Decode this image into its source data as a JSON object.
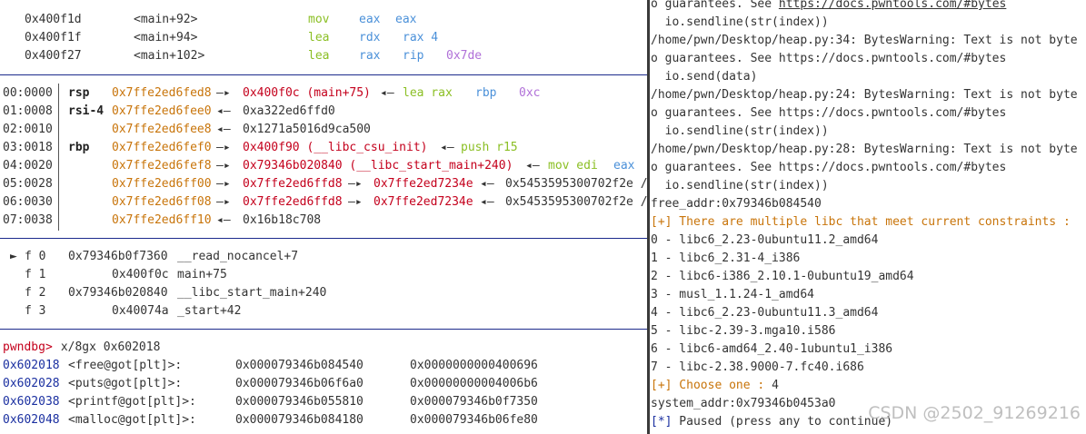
{
  "disasm": [
    {
      "addr": "0x400f1d",
      "sym": "<main+92>",
      "mn": "mov",
      "o1": "eax",
      "o2": "eax",
      "o3": ""
    },
    {
      "addr": "0x400f1f",
      "sym": "<main+94>",
      "mn": "lea",
      "o1": "rdx",
      "o2": "rax 4",
      "o3": ""
    },
    {
      "addr": "0x400f27",
      "sym": "<main+102>",
      "mn": "lea",
      "o1": "rax",
      "o2": "rip",
      "o3": "0x7de"
    }
  ],
  "stack": [
    {
      "off": "00:0000",
      "reg": "rsp",
      "addr": "0x7ffe2ed6fed8",
      "arrow": "—▸",
      "v1": "0x400f0c (main+75)",
      "a2": "◂—",
      "v2": "lea rax",
      "v3": "rbp",
      "v4": "0xc"
    },
    {
      "off": "01:0008",
      "reg": "rsi-4",
      "addr": "0x7ffe2ed6fee0",
      "arrow": "◂—",
      "v1": "0xa322ed6ffd0"
    },
    {
      "off": "02:0010",
      "reg": "",
      "addr": "0x7ffe2ed6fee8",
      "arrow": "◂—",
      "v1": "0x1271a5016d9ca500"
    },
    {
      "off": "03:0018",
      "reg": "rbp",
      "addr": "0x7ffe2ed6fef0",
      "arrow": "—▸",
      "v1": "0x400f90 (__libc_csu_init)",
      "a2": "◂—",
      "v2": "push r15"
    },
    {
      "off": "04:0020",
      "reg": "",
      "addr": "0x7ffe2ed6fef8",
      "arrow": "—▸",
      "v1": "0x79346b020840 (__libc_start_main+240)",
      "a2": "◂—",
      "v2": "mov edi",
      "v3": "eax"
    },
    {
      "off": "05:0028",
      "reg": "",
      "addr": "0x7ffe2ed6ff00",
      "arrow": "—▸",
      "v1": "0x7ffe2ed6ffd8",
      "a2": "—▸",
      "v2": "0x7ffe2ed7234e",
      "a3": "◂—",
      "v3": "0x5453595300702f2e /"
    },
    {
      "off": "06:0030",
      "reg": "",
      "addr": "0x7ffe2ed6ff08",
      "arrow": "—▸",
      "v1": "0x7ffe2ed6ffd8",
      "a2": "—▸",
      "v2": "0x7ffe2ed7234e",
      "a3": "◂—",
      "v3": "0x5453595300702f2e /"
    },
    {
      "off": "07:0038",
      "reg": "",
      "addr": "0x7ffe2ed6ff10",
      "arrow": "◂—",
      "v1": "0x16b18c708"
    }
  ],
  "backtrace": [
    {
      "mark": "►",
      "frame": "f 0",
      "addr": "0x79346b0f7360",
      "sym": "__read_nocancel+7"
    },
    {
      "mark": "",
      "frame": "f 1",
      "addr": "0x400f0c",
      "sym": "main+75"
    },
    {
      "mark": "",
      "frame": "f 2",
      "addr": "0x79346b020840",
      "sym": "__libc_start_main+240"
    },
    {
      "mark": "",
      "frame": "f 3",
      "addr": "0x40074a",
      "sym": "_start+42"
    }
  ],
  "prompt": {
    "label": "pwndbg>",
    "cmd": " x/8gx 0x602018"
  },
  "got": [
    {
      "addr": "0x602018",
      "sym": "<free@got[plt]>:",
      "v1": "0x000079346b084540",
      "v2": "0x0000000000400696"
    },
    {
      "addr": "0x602028",
      "sym": "<puts@got[plt]>:",
      "v1": "0x000079346b06f6a0",
      "v2": "0x00000000004006b6"
    },
    {
      "addr": "0x602038",
      "sym": "<printf@got[plt]>:",
      "v1": "0x000079346b055810",
      "v2": "0x000079346b0f7350"
    },
    {
      "addr": "0x602048",
      "sym": "<malloc@got[plt]>:",
      "v1": "0x000079346b084180",
      "v2": "0x000079346b06fe80"
    }
  ],
  "right": {
    "l0": {
      "pre": "o guarantees. See ",
      "url": "https://docs.pwntools.com/#bytes"
    },
    "lines": [
      {
        "t": "  io.sendline(str(index))",
        "c": "dark"
      },
      {
        "t": "/home/pwn/Desktop/heap.py:34: BytesWarning: Text is not byte",
        "c": "dark"
      },
      {
        "t": "o guarantees. See https://docs.pwntools.com/#bytes",
        "c": "dark"
      },
      {
        "t": "  io.send(data)",
        "c": "dark"
      },
      {
        "t": "/home/pwn/Desktop/heap.py:24: BytesWarning: Text is not byte",
        "c": "dark"
      },
      {
        "t": "o guarantees. See https://docs.pwntools.com/#bytes",
        "c": "dark"
      },
      {
        "t": "  io.sendline(str(index))",
        "c": "dark"
      },
      {
        "t": "/home/pwn/Desktop/heap.py:28: BytesWarning: Text is not byte",
        "c": "dark"
      },
      {
        "t": "o guarantees. See https://docs.pwntools.com/#bytes",
        "c": "dark"
      },
      {
        "t": "  io.sendline(str(index))",
        "c": "dark"
      },
      {
        "t": "free_addr:0x79346b084540",
        "c": "dark"
      },
      {
        "t": "[+] There are multiple libc that meet current constraints :",
        "c": "orange"
      },
      {
        "t": "0 - libc6_2.23-0ubuntu11.2_amd64",
        "c": "dark"
      },
      {
        "t": "1 - libc6_2.31-4_i386",
        "c": "dark"
      },
      {
        "t": "2 - libc6-i386_2.10.1-0ubuntu19_amd64",
        "c": "dark"
      },
      {
        "t": "3 - musl_1.1.24-1_amd64",
        "c": "dark"
      },
      {
        "t": "4 - libc6_2.23-0ubuntu11.3_amd64",
        "c": "dark"
      },
      {
        "t": "5 - libc-2.39-3.mga10.i586",
        "c": "dark"
      },
      {
        "t": "6 - libc6-amd64_2.40-1ubuntu1_i386",
        "c": "dark"
      },
      {
        "t": "7 - libc-2.38.9000-7.fc40.i686",
        "c": "dark"
      }
    ],
    "choose": {
      "label": "[+] Choose one : ",
      "val": "4"
    },
    "system": "system_addr:0x79346b0453a0",
    "paused": {
      "tag": "[*]",
      "text": " Paused (press any to continue)"
    }
  },
  "watermark": "CSDN @2502_91269216",
  "colors": {
    "red": "#c4001c",
    "orange": "#c8740a",
    "green": "#8bbf24",
    "blue": "#4a90d9",
    "purple": "#b070d8",
    "navy": "#1a2fa0"
  }
}
